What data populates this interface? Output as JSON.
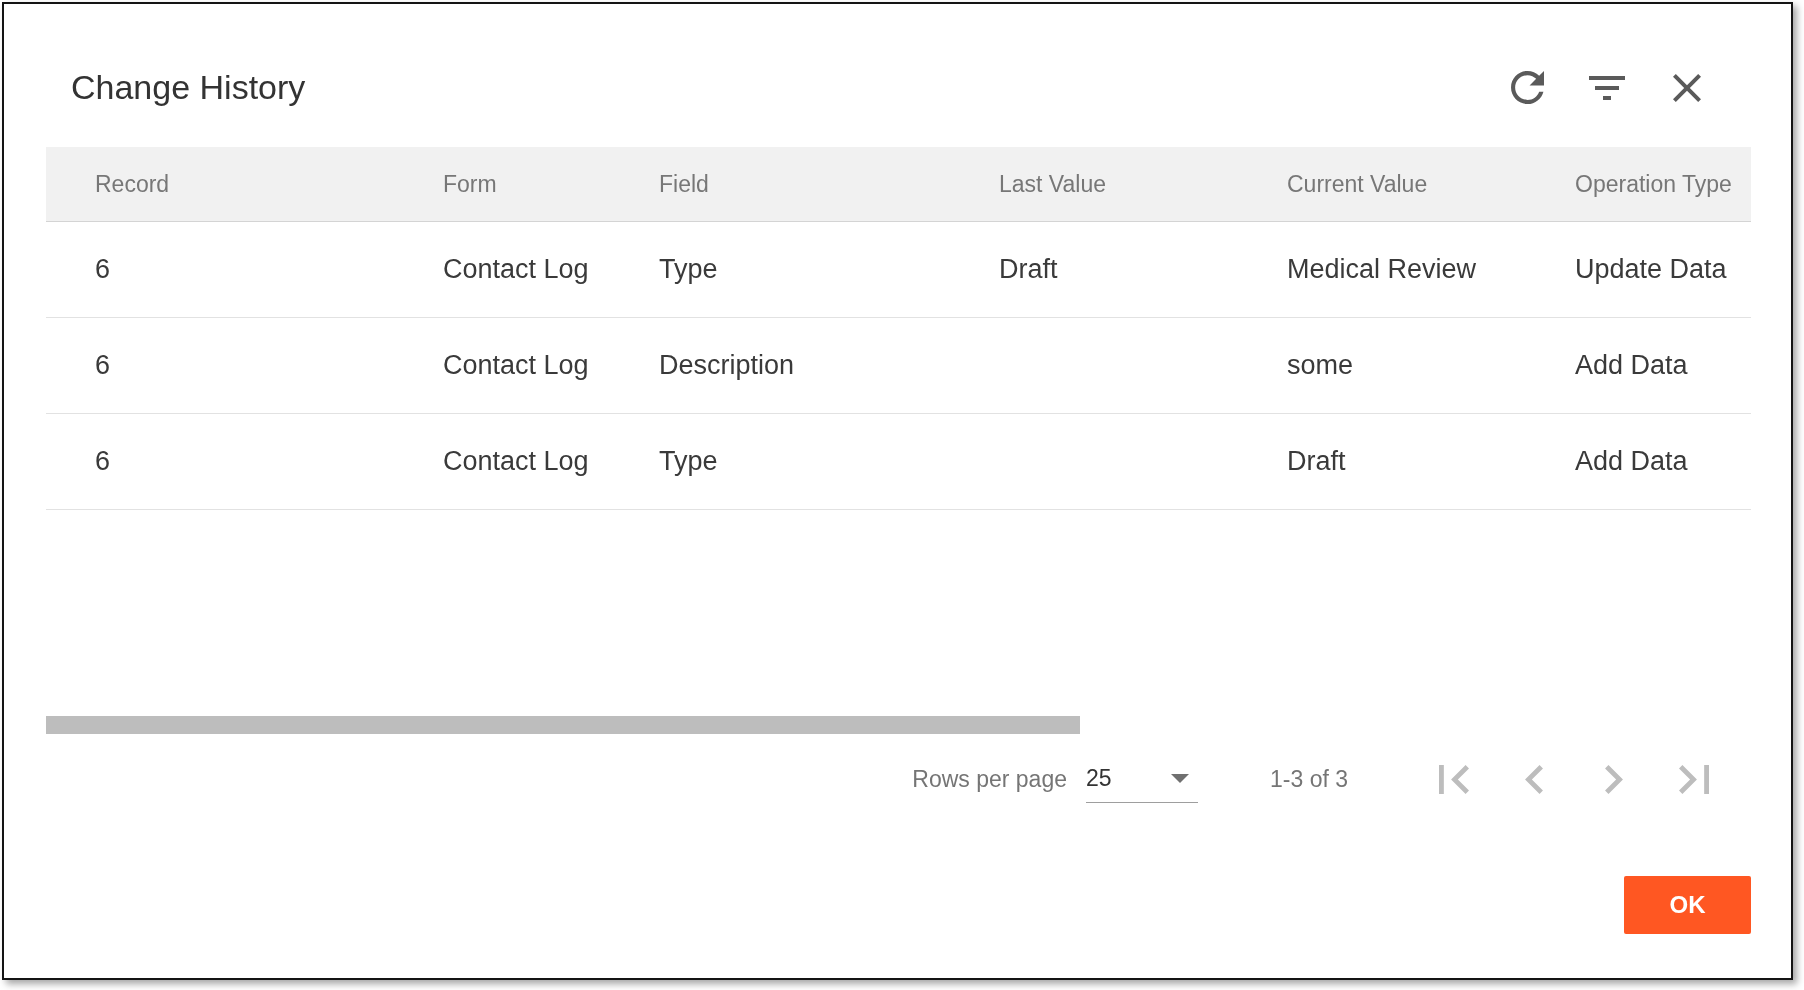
{
  "dialog": {
    "title": "Change History"
  },
  "table": {
    "columns": [
      "Record",
      "Form",
      "Field",
      "Last Value",
      "Current Value",
      "Operation Type"
    ],
    "rows": [
      {
        "record": "6",
        "form": "Contact Log",
        "field": "Type",
        "last_value": "Draft",
        "current_value": "Medical Review",
        "operation_type": "Update Data"
      },
      {
        "record": "6",
        "form": "Contact Log",
        "field": "Description",
        "current_value": "some",
        "operation_type": "Add Data"
      },
      {
        "record": "6",
        "form": "Contact Log",
        "field": "Type",
        "current_value": "Draft",
        "operation_type": "Add Data"
      }
    ]
  },
  "pagination": {
    "rows_per_page_label": "Rows per page",
    "rows_per_page": "25",
    "range": "1-3 of 3",
    "buttons": [
      {
        "kind": "first",
        "disabled": true
      },
      {
        "kind": "previous",
        "disabled": true
      },
      {
        "kind": "next",
        "disabled": true
      },
      {
        "kind": "last",
        "disabled": true
      }
    ]
  },
  "ok_button": {
    "label": "OK"
  }
}
